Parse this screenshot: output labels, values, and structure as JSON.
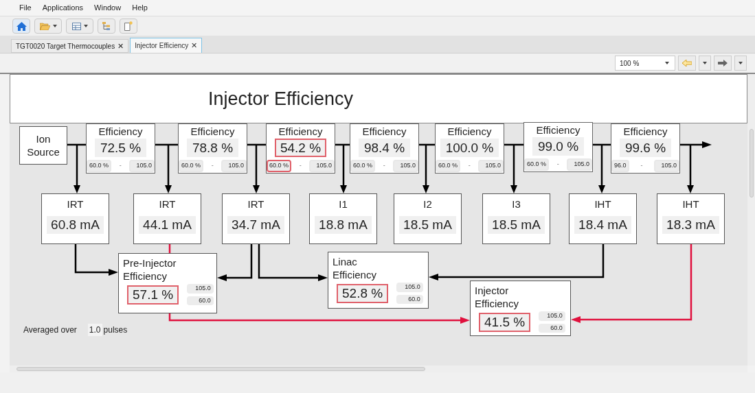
{
  "menu": [
    "File",
    "Applications",
    "Window",
    "Help"
  ],
  "tabs": [
    {
      "label": "TGT0020 Target Thermocouples",
      "close": "✕",
      "selected": false
    },
    {
      "label": "Injector Efficiency",
      "close": "✕",
      "selected": true
    }
  ],
  "zoom": {
    "value": "100 %"
  },
  "title": "Injector Efficiency",
  "source": {
    "label": "Ion Source"
  },
  "stages": [
    {
      "label": "Efficiency",
      "value": "72.5 %",
      "alarm": false,
      "low": "60.0 %",
      "low_alarm": false,
      "separator": "-",
      "high": "105.0"
    },
    {
      "label": "Efficiency",
      "value": "78.8 %",
      "alarm": false,
      "low": "60.0 %",
      "low_alarm": false,
      "separator": "-",
      "high": "105.0"
    },
    {
      "label": "Efficiency",
      "value": "54.2 %",
      "alarm": true,
      "low": "60.0 %",
      "low_alarm": true,
      "separator": "-",
      "high": "105.0"
    },
    {
      "label": "Efficiency",
      "value": "98.4 %",
      "alarm": false,
      "low": "60.0 %",
      "low_alarm": false,
      "separator": "-",
      "high": "105.0"
    },
    {
      "label": "Efficiency",
      "value": "100.0 %",
      "alarm": false,
      "low": "60.0 %",
      "low_alarm": false,
      "separator": "-",
      "high": "105.0"
    },
    {
      "label": "Efficiency",
      "value": "99.0 %",
      "alarm": false,
      "low": "60.0 %",
      "low_alarm": false,
      "separator": "-",
      "high": "105.0"
    },
    {
      "label": "Efficiency",
      "value": "99.6 %",
      "alarm": false,
      "low": "96.0",
      "low_alarm": false,
      "separator": "-",
      "high": "105.0"
    }
  ],
  "monitors": [
    {
      "label": "IRT",
      "value": "60.8 mA"
    },
    {
      "label": "IRT",
      "value": "44.1 mA"
    },
    {
      "label": "IRT",
      "value": "34.7 mA"
    },
    {
      "label": "I1",
      "value": "18.8 mA"
    },
    {
      "label": "I2",
      "value": "18.5 mA"
    },
    {
      "label": "I3",
      "value": "18.5 mA"
    },
    {
      "label": "IHT",
      "value": "18.4 mA"
    },
    {
      "label": "IHT",
      "value": "18.3 mA"
    }
  ],
  "summaries": [
    {
      "label": "Pre-Injector Efficiency",
      "value": "57.1 %",
      "alarm": true,
      "high": "105.0",
      "low": "60.0"
    },
    {
      "label": "Linac Efficiency",
      "value": "52.8 %",
      "alarm": true,
      "high": "105.0",
      "low": "60.0"
    },
    {
      "label": "Injector Efficiency",
      "value": "41.5 %",
      "alarm": true,
      "high": "105.0",
      "low": "60.0"
    }
  ],
  "averaging": {
    "label": "Averaged over",
    "value": "1.0",
    "unit": "pulses"
  }
}
